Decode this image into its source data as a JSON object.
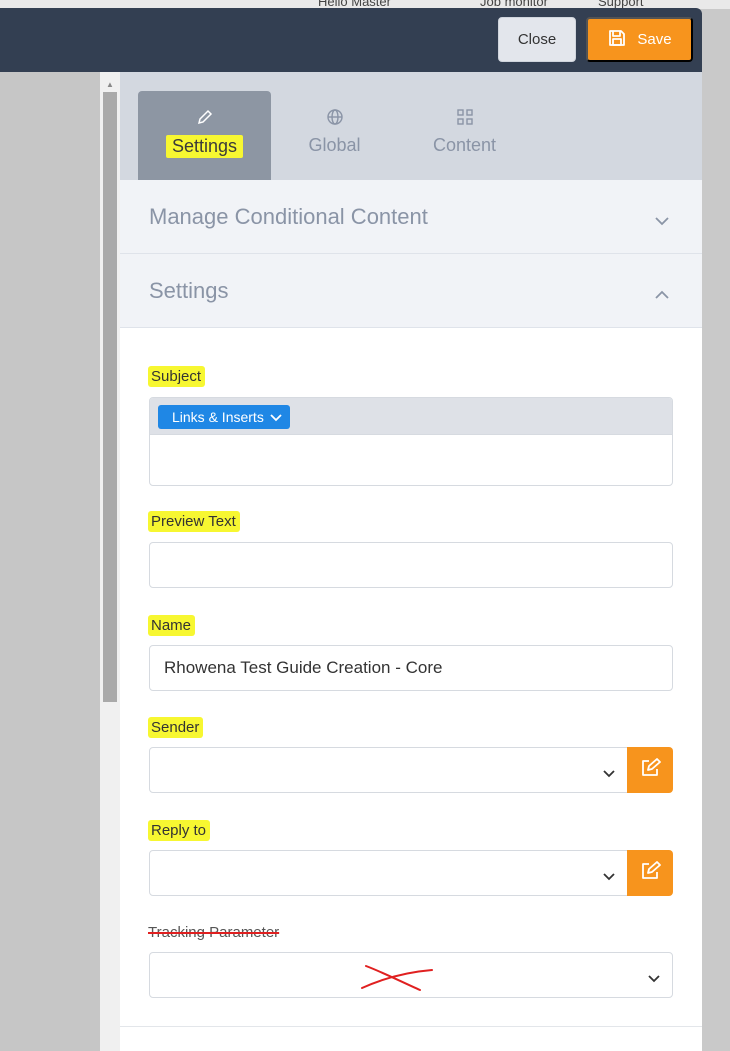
{
  "header": {
    "greeting": "Hello Master",
    "job_monitor": "Job monitor",
    "support": "Support",
    "close_label": "Close",
    "save_label": "Save"
  },
  "tabs": [
    {
      "label": "Settings",
      "icon": "pencil-icon",
      "active": true
    },
    {
      "label": "Global",
      "icon": "globe-icon",
      "active": false
    },
    {
      "label": "Content",
      "icon": "grid-icon",
      "active": false
    }
  ],
  "sections": {
    "conditional_title": "Manage Conditional Content",
    "settings_title": "Settings"
  },
  "form": {
    "subject_label": "Subject",
    "links_inserts_label": "Links & Inserts",
    "subject_value": "",
    "preview_label": "Preview Text",
    "preview_value": "",
    "name_label": "Name",
    "name_value": "Rhowena Test Guide Creation - Core",
    "sender_label": "Sender",
    "sender_value": "",
    "reply_to_label": "Reply to",
    "reply_to_value": "",
    "tracking_label": "Tracking Parameter",
    "tracking_value": ""
  },
  "colors": {
    "topbar": "#333f52",
    "accent_orange": "#f7941d",
    "links_blue": "#1f87e5",
    "highlight_yellow": "#f7f731",
    "annotation_red": "#e02020"
  }
}
